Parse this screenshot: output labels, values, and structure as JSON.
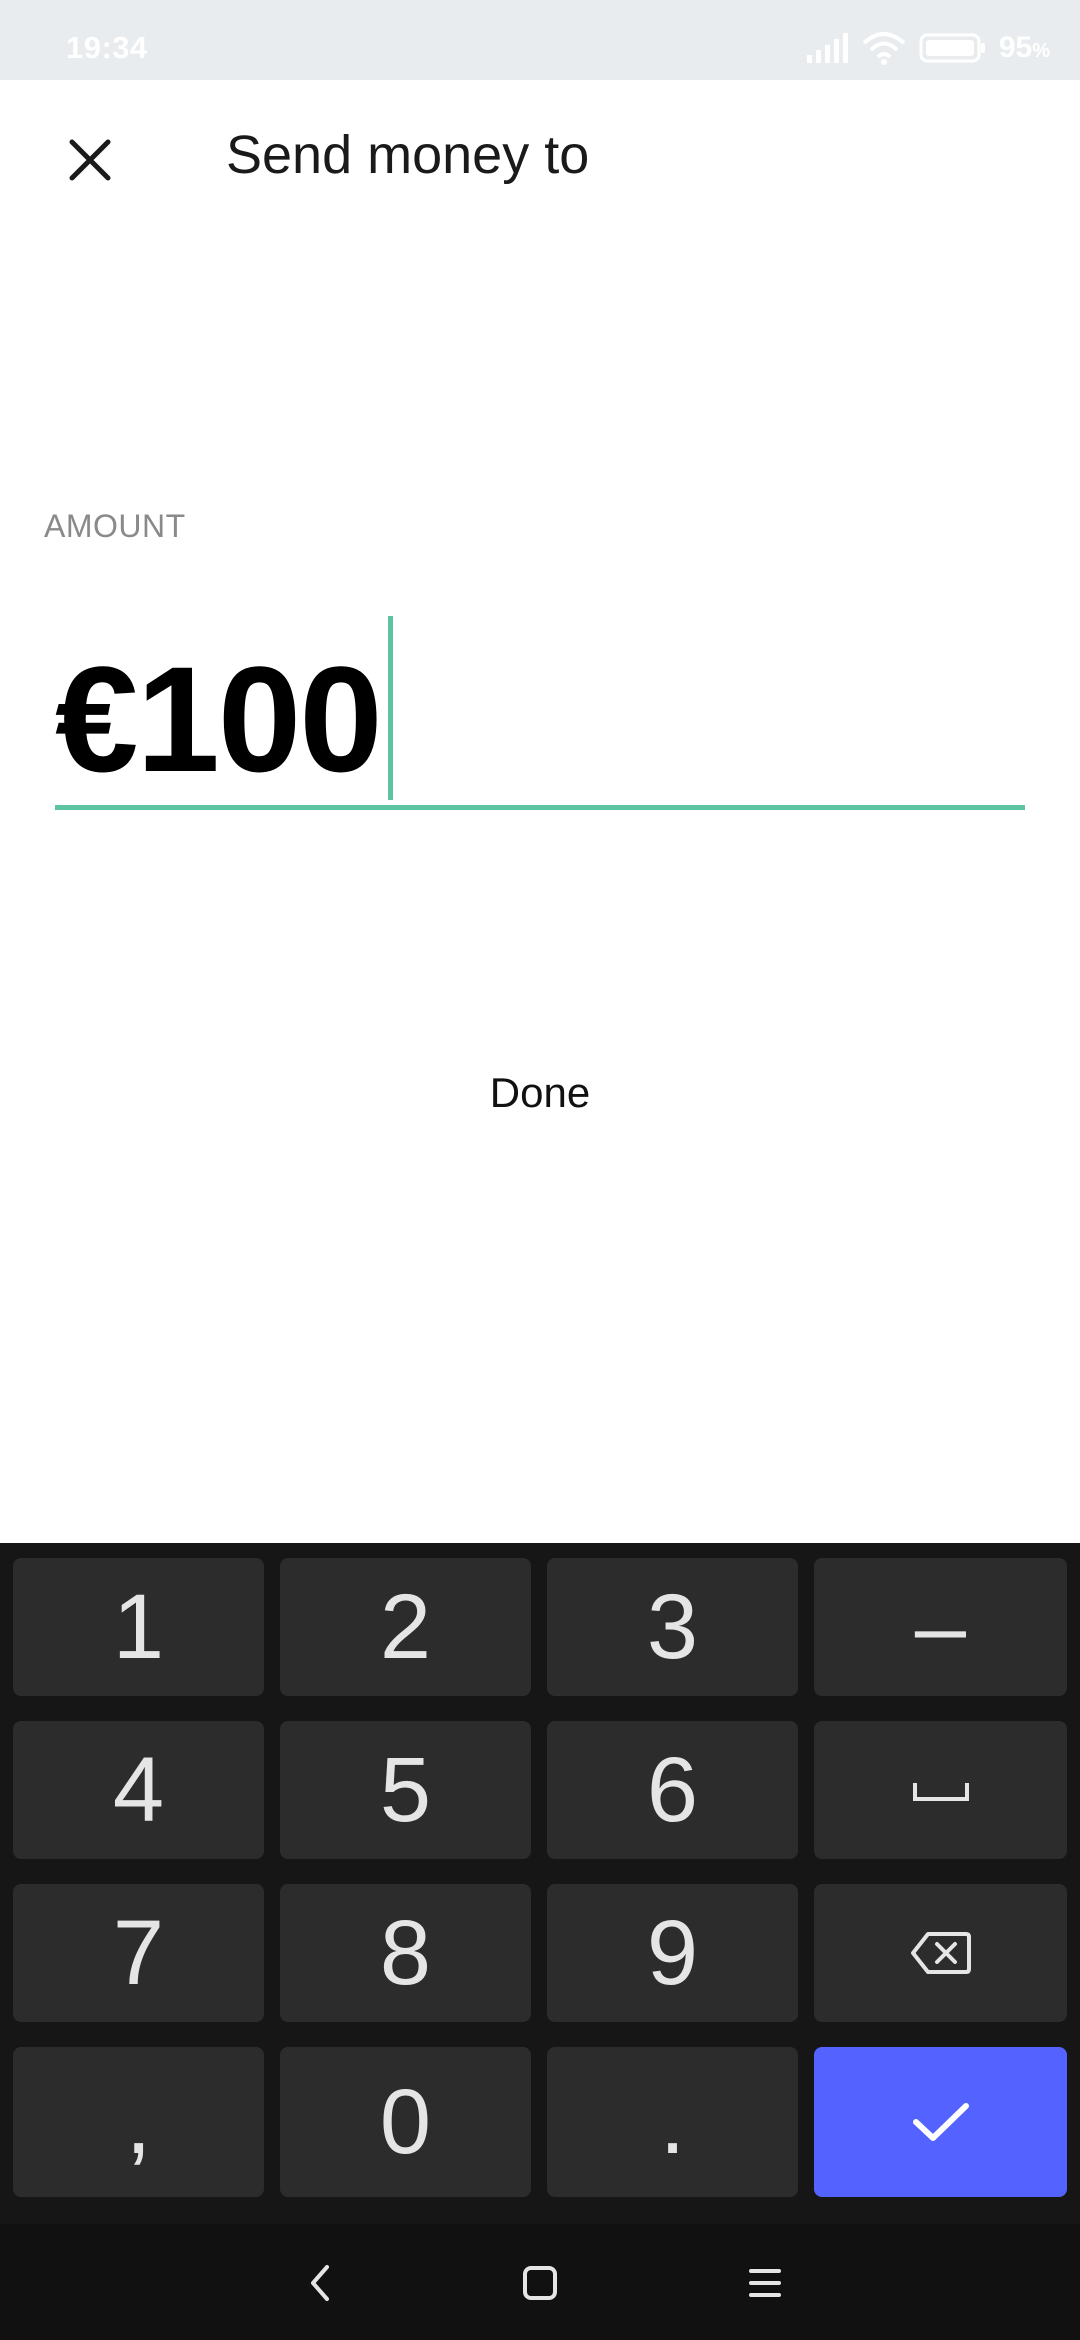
{
  "status_bar": {
    "time": "19:34",
    "battery_value": "95",
    "battery_unit": "%"
  },
  "header": {
    "title": "Send money to",
    "close_icon": "close-icon"
  },
  "amount": {
    "label": "AMOUNT",
    "value": "€100",
    "accent_color": "#5cc5a0"
  },
  "done_label": "Done",
  "keypad": {
    "rows": [
      [
        "1",
        "2",
        "3",
        "–"
      ],
      [
        "4",
        "5",
        "6",
        "space-icon"
      ],
      [
        "7",
        "8",
        "9",
        "backspace-icon"
      ],
      [
        ",",
        "0",
        ".",
        "check-icon"
      ]
    ],
    "confirm_color": "#5463ff"
  },
  "nav_bar": {
    "icons": [
      "back-icon",
      "home-icon",
      "recents-icon"
    ]
  }
}
